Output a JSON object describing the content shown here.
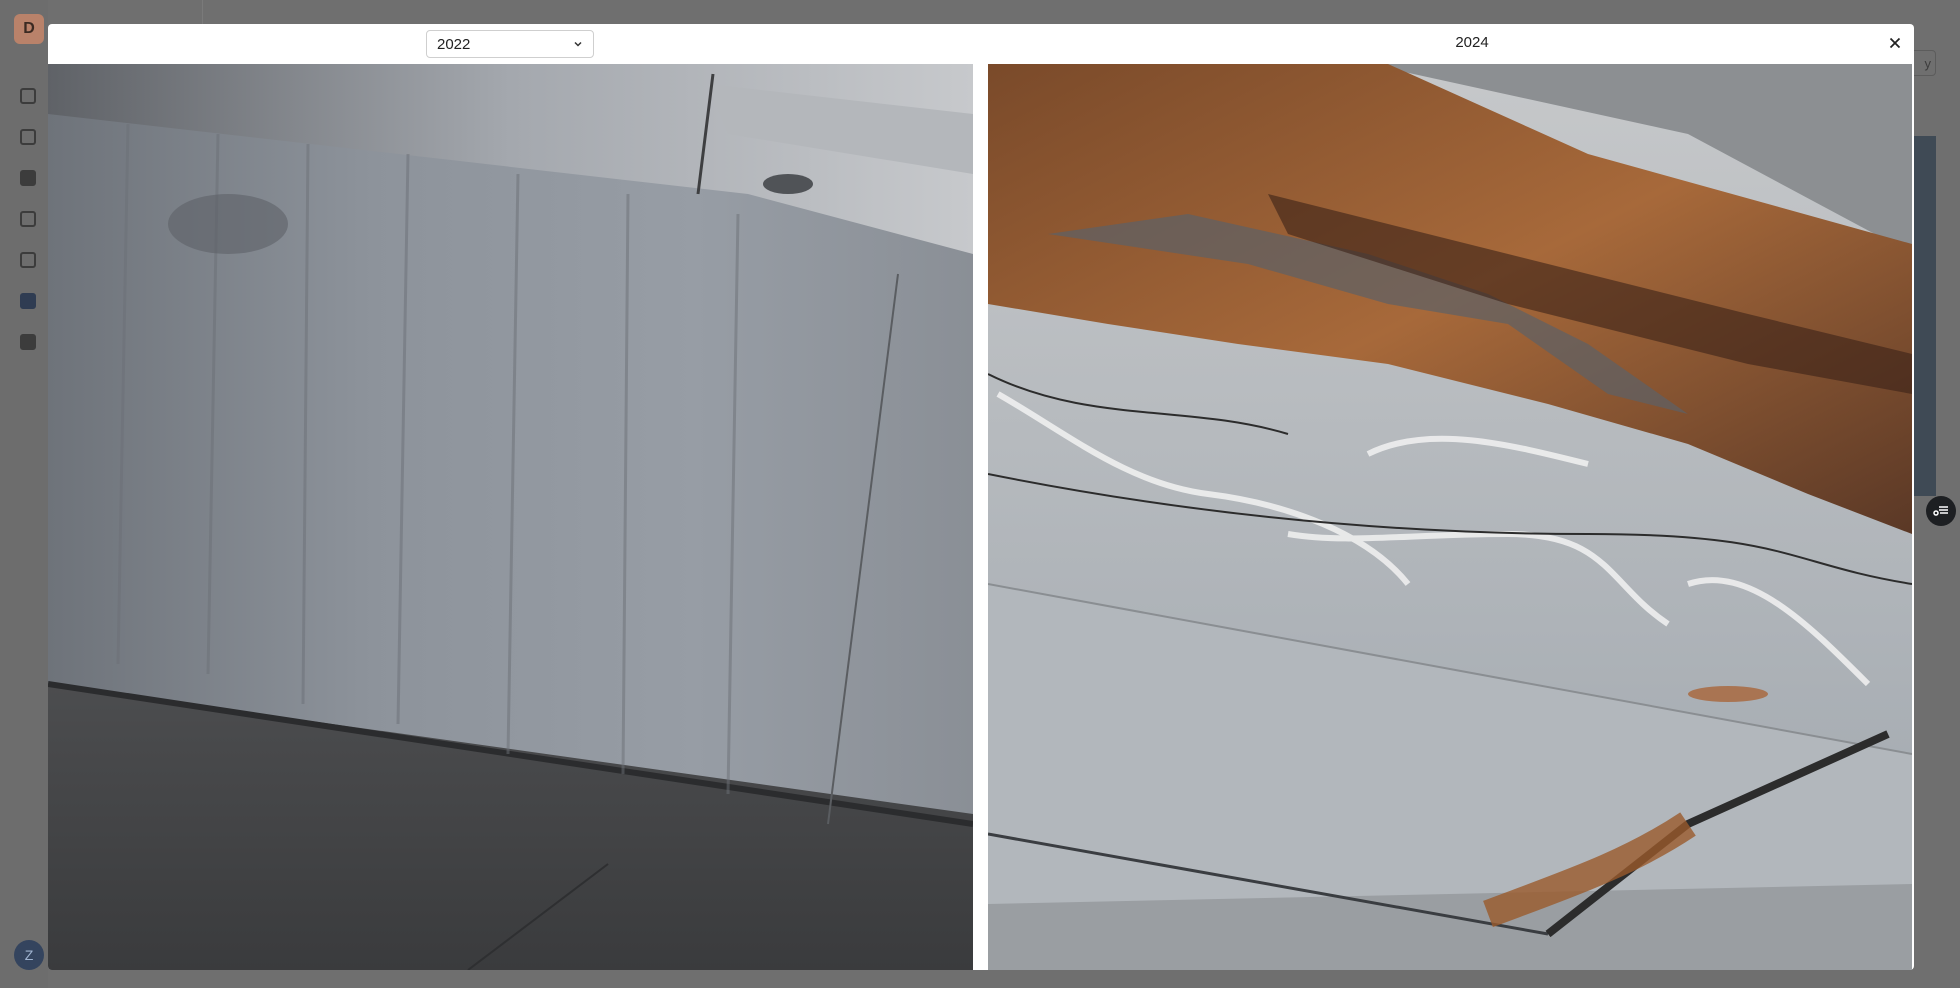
{
  "sidebar": {
    "org_initial": "D",
    "user_initial": "Z",
    "nav_icons": [
      "dashboard-icon",
      "document-icon",
      "image-icon",
      "chart-icon",
      "bar-chart-icon",
      "network-icon",
      "gallery-icon"
    ]
  },
  "modal": {
    "left_select": {
      "value": "2022"
    },
    "right_label": "2024"
  },
  "colors": {
    "overlay": "#6f6f6f",
    "modal_bg": "#ffffff",
    "concrete": "#8f949a",
    "rust": "#9a5a2c"
  }
}
